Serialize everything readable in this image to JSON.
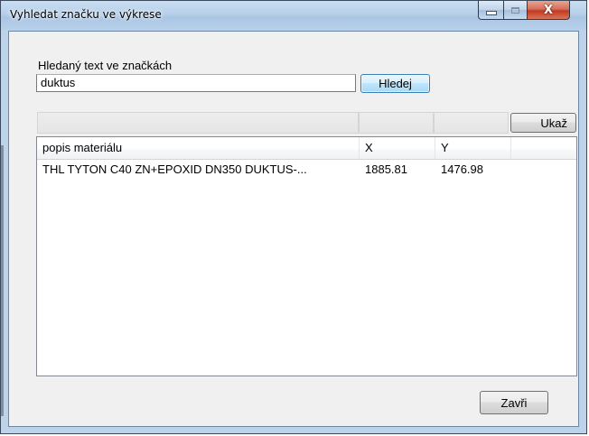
{
  "window": {
    "title": "Vyhledat značku ve výkrese",
    "controls": {
      "minimize_icon": "minimize-icon",
      "maximize_icon": "maximize-icon",
      "close_glyph": "X"
    }
  },
  "search": {
    "label": "Hledaný text ve značkách",
    "value": "duktus",
    "button_label": "Hledej"
  },
  "filter": {
    "show_button_label": "Ukaž"
  },
  "results": {
    "columns": [
      "popis materiálu",
      "X",
      "Y",
      ""
    ],
    "rows": [
      {
        "description": "THL TYTON C40 ZN+EPOXID DN350 DUKTUS-...",
        "x": "1885.81",
        "y": "1476.98"
      }
    ]
  },
  "footer": {
    "close_button_label": "Zavři"
  }
}
